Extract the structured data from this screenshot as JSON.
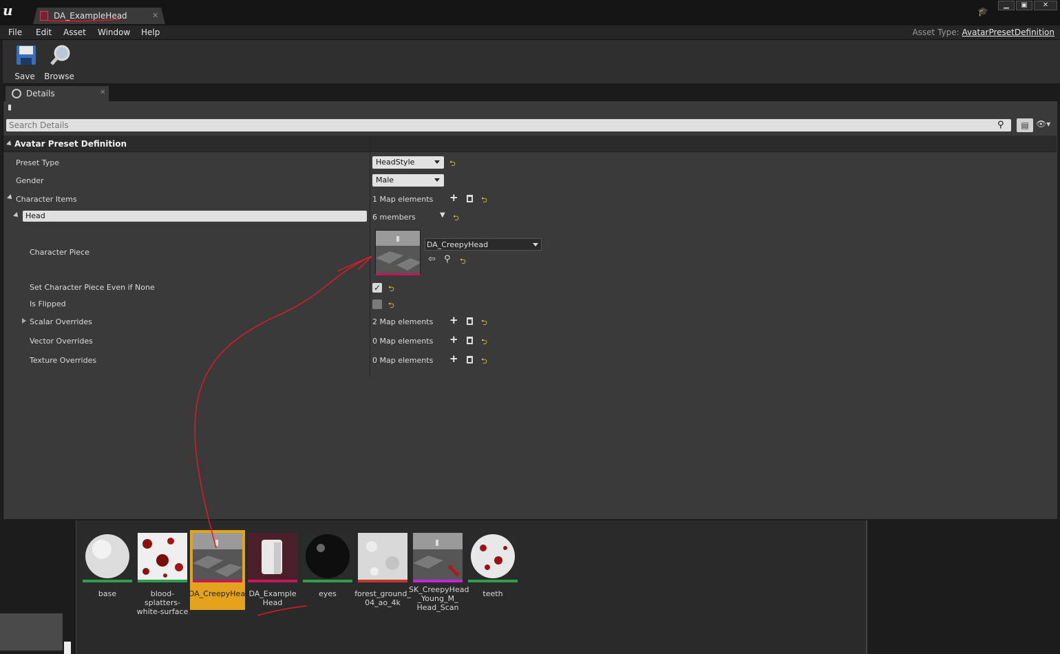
{
  "window": {
    "tab_label": "DA_ExampleHead",
    "minimize": "▁",
    "maximize": "▣",
    "close": "✕"
  },
  "menu": {
    "items": [
      "File",
      "Edit",
      "Asset",
      "Window",
      "Help"
    ],
    "asset_type_label": "Asset Type:",
    "asset_type_value": "AvatarPresetDefinition"
  },
  "toolbar": {
    "save_label": "Save",
    "browse_label": "Browse"
  },
  "details": {
    "tab_label": "Details",
    "search_placeholder": "Search Details",
    "category": "Avatar Preset Definition",
    "preset_type_label": "Preset Type",
    "preset_type_value": "HeadStyle",
    "gender_label": "Gender",
    "gender_value": "Male",
    "character_items_label": "Character Items",
    "character_items_value": "1 Map elements",
    "head_key": "Head",
    "head_members": "6 members",
    "character_piece_label": "Character Piece",
    "character_piece_value": "DA_CreepyHead",
    "set_even_if_none_label": "Set Character Piece Even if None",
    "set_even_if_none_checked": true,
    "is_flipped_label": "Is Flipped",
    "is_flipped_checked": false,
    "scalar_overrides_label": "Scalar Overrides",
    "scalar_overrides_value": "2 Map elements",
    "vector_overrides_label": "Vector Overrides",
    "vector_overrides_value": "0 Map elements",
    "texture_overrides_label": "Texture Overrides",
    "texture_overrides_value": "0 Map elements"
  },
  "content_browser": {
    "assets": [
      {
        "name": "base",
        "stripe": "#2e9e4a"
      },
      {
        "name": "blood-splatters-\nwhite-surface",
        "stripe": "#2e9e4a"
      },
      {
        "name": "DA_CreepyHead",
        "stripe": "#c2185b",
        "selected": true
      },
      {
        "name": "DA_Example\nHead",
        "stripe": "#c2185b"
      },
      {
        "name": "eyes",
        "stripe": "#2e9e4a"
      },
      {
        "name": "forest_ground_\n04_ao_4k",
        "stripe": "#c0392b"
      },
      {
        "name": "SK_CreepyHead\n_Young_M_\nHead_Scan",
        "stripe": "#c026d3"
      },
      {
        "name": "teeth",
        "stripe": "#2e9e4a"
      }
    ]
  },
  "colors": {
    "reset_arrow": "#e5d22a",
    "selection": "#e5a21b",
    "annotation": "#e01b24"
  }
}
